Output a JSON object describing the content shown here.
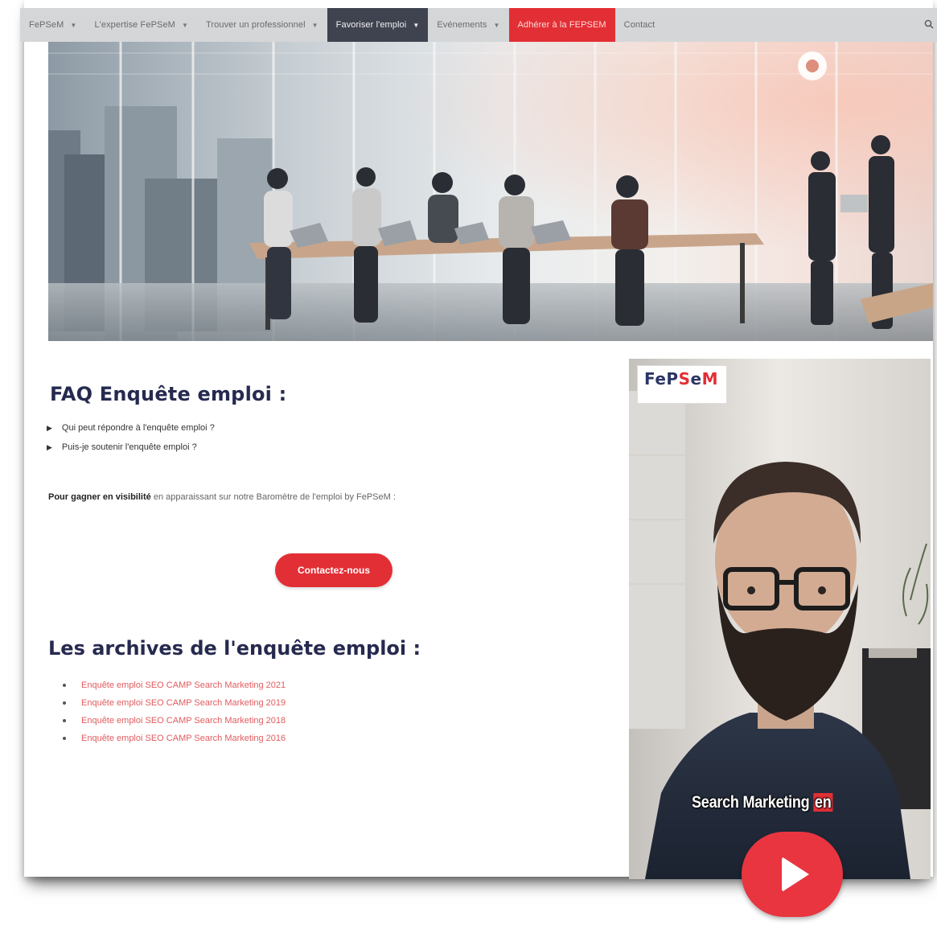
{
  "nav": {
    "items": [
      {
        "label": "FePSeM",
        "dropdown": true
      },
      {
        "label": "L'expertise FePSeM",
        "dropdown": true
      },
      {
        "label": "Trouver un professionnel",
        "dropdown": true
      },
      {
        "label": "Favoriser l'emploi",
        "dropdown": true,
        "active": true
      },
      {
        "label": "Evénements",
        "dropdown": true
      },
      {
        "label": "Adhérer à la FEPSEM",
        "dropdown": false,
        "cta": true
      },
      {
        "label": "Contact",
        "dropdown": false
      }
    ],
    "search_icon": "search-icon"
  },
  "faq": {
    "title": "FAQ Enquête emploi :",
    "items": [
      "Qui peut répondre à l'enquête emploi ?",
      "Puis-je soutenir l'enquête emploi ?"
    ]
  },
  "visibility": {
    "bold": "Pour gagner en visibilité",
    "rest": " en apparaissant sur notre Baromètre de l'emploi by FePSeM :"
  },
  "contact_button": "Contactez-nous",
  "archives": {
    "title": "Les archives de l'enquête emploi :",
    "links": [
      "Enquête emploi SEO CAMP Search Marketing 2021",
      "Enquête emploi SEO CAMP Search Marketing 2019",
      "Enquête emploi SEO CAMP Search Marketing 2018",
      "Enquête emploi SEO CAMP Search Marketing 2016"
    ]
  },
  "video": {
    "logo_parts": [
      "FeP",
      "S",
      "e",
      "M"
    ],
    "caption_main": "Search Marketing ",
    "caption_highlight": "en"
  },
  "colors": {
    "brand_red": "#e22f35",
    "navy": "#262a4f",
    "nav_bg": "#d5d6d8",
    "nav_active": "#3f4350"
  }
}
